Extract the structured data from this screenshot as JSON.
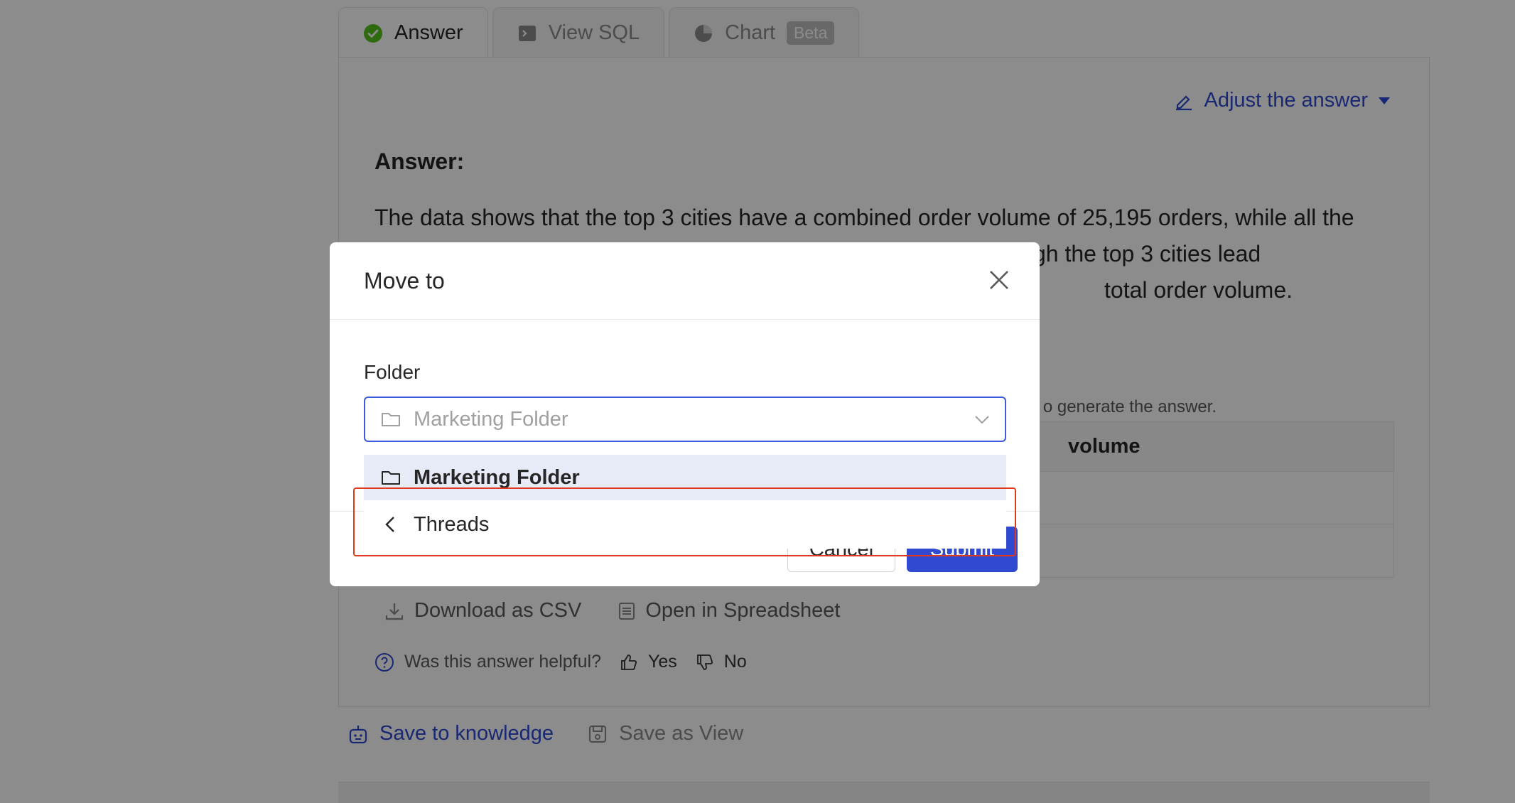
{
  "tabs": [
    {
      "label": "Answer",
      "icon": "check-circle-icon",
      "active": true
    },
    {
      "label": "View SQL",
      "icon": "terminal-icon",
      "active": false
    },
    {
      "label": "Chart",
      "icon": "pie-chart-icon",
      "badge": "Beta",
      "active": false
    }
  ],
  "answer": {
    "adjust_label": "Adjust the answer",
    "title": "Answer:",
    "text_line1": "The data shows that the top 3 cities have a combined order volume of 25,195 orders, while all the",
    "text_line2": "gh the top 3 cities lead",
    "text_line3": "total order volume.",
    "table_note": "o generate the answer.",
    "table_column": "volume"
  },
  "tools": {
    "download_label": "Download as CSV",
    "spreadsheet_label": "Open in Spreadsheet"
  },
  "feedback": {
    "question": "Was this answer helpful?",
    "yes_label": "Yes",
    "no_label": "No"
  },
  "actions": {
    "save_knowledge_label": "Save to knowledge",
    "save_view_label": "Save as View"
  },
  "modal": {
    "title": "Move to",
    "folder_label": "Folder",
    "select_placeholder": "Marketing Folder",
    "cancel_label": "Cancel",
    "submit_label": "Submit"
  },
  "dropdown": {
    "items": [
      {
        "label": "Marketing Folder",
        "icon": "folder-icon",
        "selected": true
      },
      {
        "label": "Threads",
        "icon": "chevron-left-icon",
        "selected": false
      }
    ]
  },
  "colors": {
    "accent": "#2f4ad1",
    "highlight_border": "#e0391d",
    "success": "#52c41a"
  }
}
